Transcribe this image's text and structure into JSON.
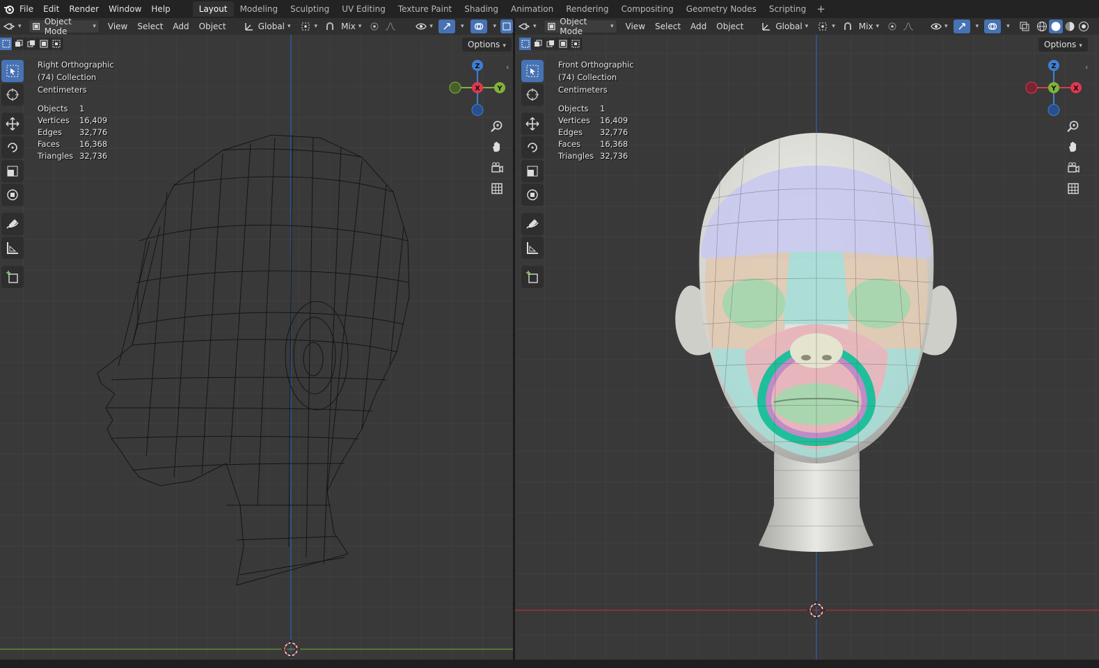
{
  "menu": {
    "items": [
      "File",
      "Edit",
      "Render",
      "Window",
      "Help"
    ]
  },
  "workspaces": {
    "tabs": [
      "Layout",
      "Modeling",
      "Sculpting",
      "UV Editing",
      "Texture Paint",
      "Shading",
      "Animation",
      "Rendering",
      "Compositing",
      "Geometry Nodes",
      "Scripting"
    ],
    "active": "Layout",
    "add_symbol": "+"
  },
  "viewport_left": {
    "header": {
      "mode": "Object Mode",
      "view": "View",
      "select": "Select",
      "add": "Add",
      "object": "Object",
      "orientation": "Global",
      "proportional": "Mix"
    },
    "options_label": "Options",
    "view_name": "Right Orthographic",
    "collection": "(74) Collection",
    "units": "Centimeters",
    "stats": [
      {
        "label": "Objects",
        "value": "1"
      },
      {
        "label": "Vertices",
        "value": "16,409"
      },
      {
        "label": "Edges",
        "value": "32,776"
      },
      {
        "label": "Faces",
        "value": "16,368"
      },
      {
        "label": "Triangles",
        "value": "32,736"
      }
    ],
    "gizmo": {
      "top": "Z",
      "center": "X",
      "right": "Y"
    }
  },
  "viewport_right": {
    "header": {
      "mode": "Object Mode",
      "view": "View",
      "select": "Select",
      "add": "Add",
      "object": "Object",
      "orientation": "Global",
      "proportional": "Mix"
    },
    "options_label": "Options",
    "view_name": "Front Orthographic",
    "collection": "(74) Collection",
    "units": "Centimeters",
    "stats": [
      {
        "label": "Objects",
        "value": "1"
      },
      {
        "label": "Vertices",
        "value": "16,409"
      },
      {
        "label": "Edges",
        "value": "32,776"
      },
      {
        "label": "Faces",
        "value": "16,368"
      },
      {
        "label": "Triangles",
        "value": "32,736"
      }
    ],
    "gizmo": {
      "top": "Z",
      "center": "Y",
      "right": "X"
    }
  },
  "colors": {
    "accent": "#4772b3",
    "axis_x": "#e0384f",
    "axis_y": "#7fb33a",
    "axis_z": "#3f7fd6",
    "grid_bg": "#393939"
  }
}
